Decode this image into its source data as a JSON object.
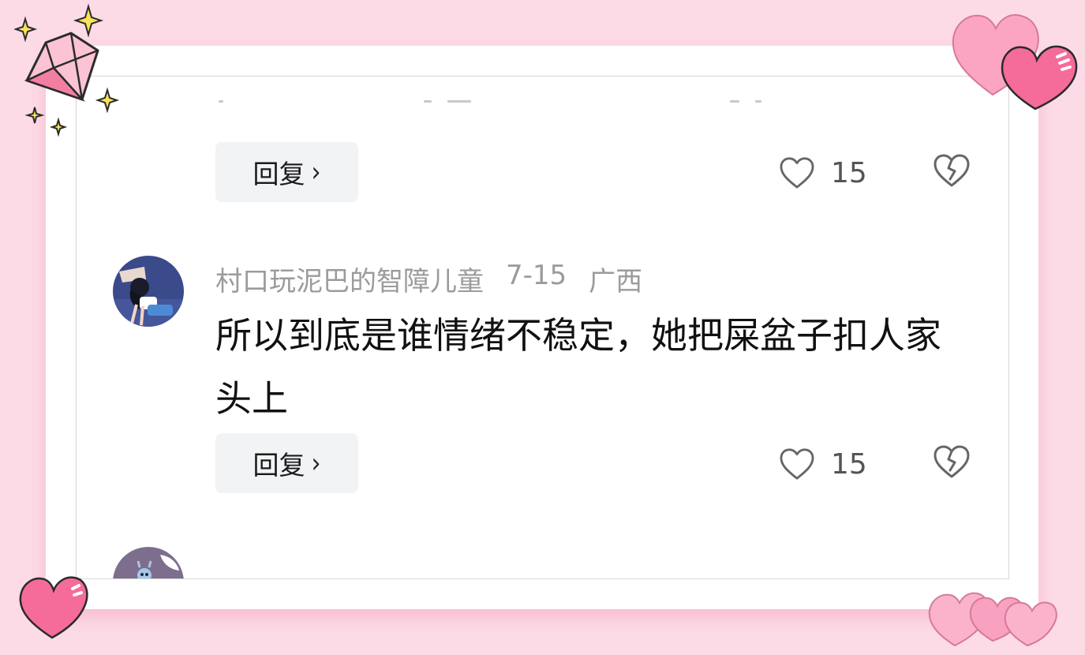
{
  "comment_top": {
    "reply_label": "回复",
    "reply_chevron": "›",
    "like_count": "15"
  },
  "comment_main": {
    "username": "村口玩泥巴的智障儿童",
    "date": "7-15",
    "location": "广西",
    "text": "所以到底是谁情绪不稳定，她把屎盆子扣人家头上",
    "reply_label": "回复",
    "reply_chevron": "›",
    "like_count": "15"
  },
  "icons": {
    "like": "heart-outline-icon",
    "dislike": "broken-heart-icon",
    "reply_arrow": "chevron-right-icon"
  },
  "decorations": [
    "diamond-sticker",
    "sparkle-stars",
    "pink-hearts-top-right",
    "pink-heart-bottom-left",
    "pink-hearts-bottom-right"
  ],
  "colors": {
    "background": "#fcdbe7",
    "card": "#ffffff",
    "reply_button_bg": "#f2f3f5",
    "meta_text": "#9b9b9b",
    "comment_text": "#111111",
    "icon_gray": "#666666"
  }
}
